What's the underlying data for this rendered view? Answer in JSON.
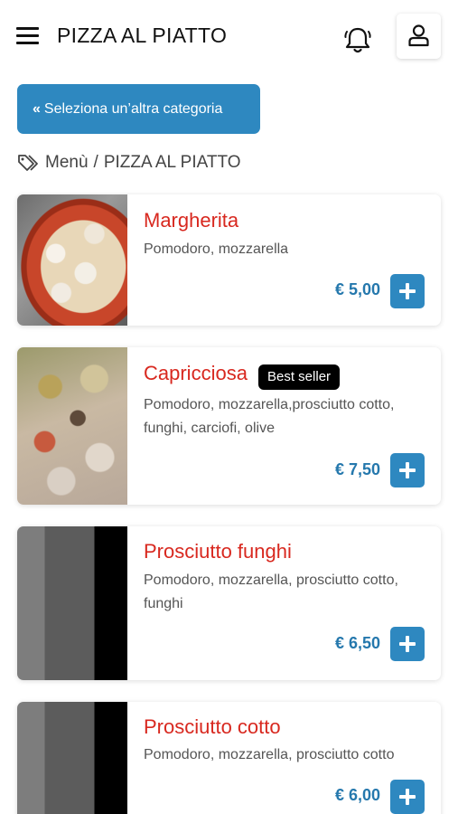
{
  "header": {
    "title": "PIZZA AL PIATTO"
  },
  "back_button": {
    "chevron": "«",
    "label": "Seleziona un’altra categoria"
  },
  "breadcrumb": {
    "root": "Menù",
    "separator": "/",
    "current": "PIZZA AL PIATTO"
  },
  "colors": {
    "accent": "#2e88c0",
    "price": "#2578ad",
    "item_name": "#d8281f"
  },
  "items": [
    {
      "name": "Margherita",
      "description": "Pomodoro, mozzarella",
      "price": "€ 5,00",
      "badge": ""
    },
    {
      "name": "Capricciosa",
      "description": "Pomodoro, mozzarella,prosciutto cotto, funghi, carciofi, olive",
      "price": "€ 7,50",
      "badge": "Best seller"
    },
    {
      "name": "Prosciutto funghi",
      "description": "Pomodoro, mozzarella, prosciutto cotto, funghi",
      "price": "€ 6,50",
      "badge": ""
    },
    {
      "name": "Prosciutto cotto",
      "description": "Pomodoro, mozzarella, prosciutto cotto",
      "price": "€ 6,00",
      "badge": ""
    }
  ]
}
